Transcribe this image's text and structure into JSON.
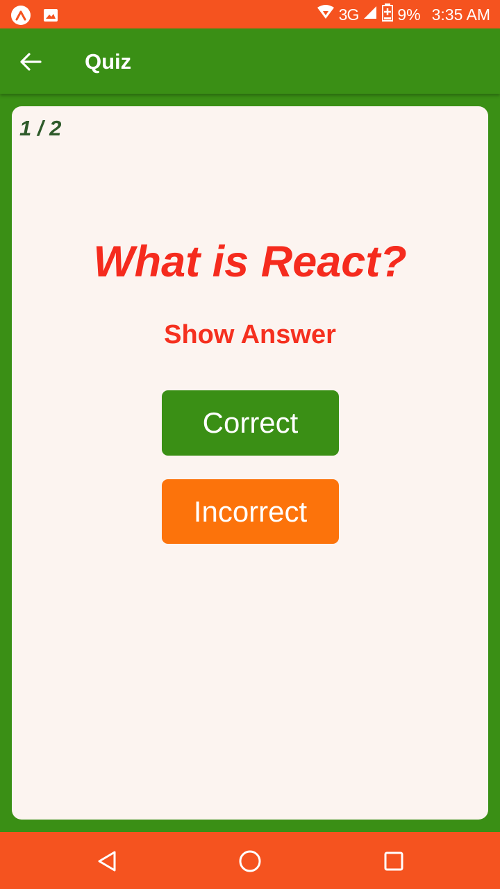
{
  "status_bar": {
    "network": "3G",
    "battery": "9%",
    "time": "3:35 AM",
    "icons": [
      "app-logo-icon",
      "image-icon",
      "wifi-icon",
      "signal-icon",
      "battery-charging-icon"
    ]
  },
  "app_bar": {
    "title": "Quiz",
    "back_icon": "back-arrow-icon"
  },
  "quiz": {
    "progress": "1 / 2",
    "question": "What is React?",
    "show_answer_label": "Show Answer",
    "correct_label": "Correct",
    "incorrect_label": "Incorrect"
  },
  "nav_bar": {
    "icons": [
      "back-triangle-icon",
      "home-circle-icon",
      "recents-square-icon"
    ]
  },
  "colors": {
    "status_bar": "#f5531f",
    "app_bar": "#3a8f15",
    "card": "#fcf4f0",
    "question": "#f52b1e",
    "correct_button": "#3a8f15",
    "incorrect_button": "#fc730b"
  }
}
